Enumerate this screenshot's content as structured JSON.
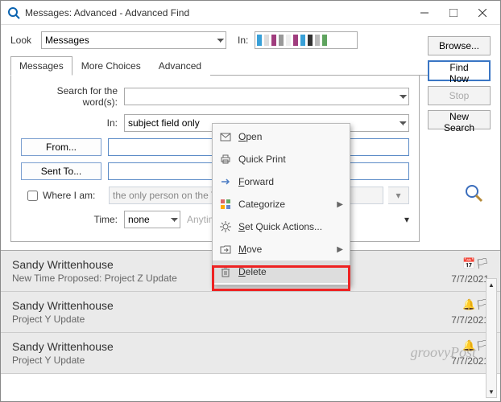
{
  "window": {
    "title": "Messages: Advanced - Advanced Find"
  },
  "look": {
    "label": "Look",
    "select_value": "Messages",
    "in_label": "In:",
    "browse_btn": "Browse..."
  },
  "tabs": {
    "messages": "Messages",
    "more_choices": "More Choices",
    "advanced": "Advanced"
  },
  "right_buttons": {
    "find_now": "Find Now",
    "stop": "Stop",
    "new_search": "New Search"
  },
  "form": {
    "search_label": "Search for the word(s):",
    "search_value": "",
    "in_label": "In:",
    "in_value": "subject field only",
    "from_btn": "From...",
    "from_value": "",
    "sent_btn": "Sent To...",
    "sent_value": "",
    "where_chk_label": "Where I am:",
    "where_value": "the only person on the To line",
    "time_label": "Time:",
    "time_value": "none",
    "time_range": "Anytime"
  },
  "context_menu": {
    "items": [
      {
        "label": "Open",
        "accel": "O",
        "icon": "open-icon"
      },
      {
        "label": "Quick Print",
        "accel": "",
        "icon": "print-icon"
      },
      {
        "label": "Forward",
        "accel": "F",
        "icon": "forward-icon"
      },
      {
        "label": "Categorize",
        "accel": "",
        "icon": "categorize-icon",
        "submenu": true
      },
      {
        "label": "Set Quick Actions...",
        "accel": "",
        "icon": "gear-icon"
      },
      {
        "label": "Move",
        "accel": "M",
        "icon": "move-icon",
        "submenu": true
      },
      {
        "label": "Delete",
        "accel": "D",
        "icon": "delete-icon"
      }
    ]
  },
  "results": [
    {
      "sender": "Sandy Writtenhouse",
      "subject": "New Time Proposed: Project Z Update",
      "date": "7/7/2021",
      "icon": "calendar-flag"
    },
    {
      "sender": "Sandy Writtenhouse",
      "subject": "Project Y Update",
      "date": "7/7/2021",
      "icon": "bell-flag"
    },
    {
      "sender": "Sandy Writtenhouse",
      "subject": "Project Y Update",
      "date": "7/7/2021",
      "icon": "bell-flag"
    }
  ],
  "watermark": "groovyPost"
}
